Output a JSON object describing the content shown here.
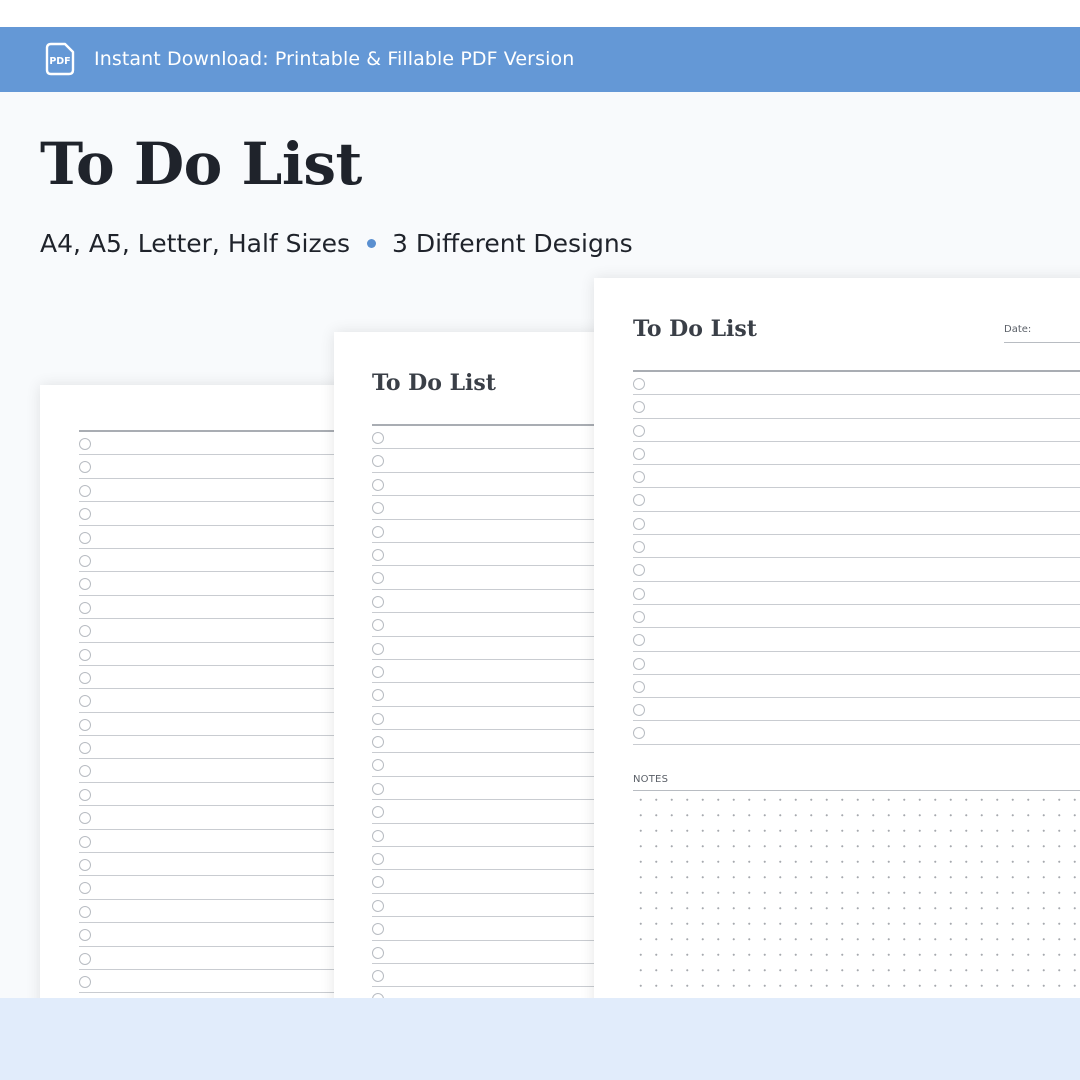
{
  "banner": {
    "icon_name": "pdf-file-icon",
    "icon_text": "PDF",
    "text": "Instant Download: Printable & Fillable PDF Version",
    "color": "#6498d6"
  },
  "title": "To Do List",
  "subtitle": {
    "left": "A4, A5, Letter, Half Sizes",
    "right": "3 Different Designs",
    "bullet_color": "#5a8fd0"
  },
  "sheets": {
    "design_1": {
      "title": "",
      "row_count": 24
    },
    "design_2": {
      "title": "To Do List",
      "row_count": 25
    },
    "design_3": {
      "title": "To Do List",
      "date_label": "Date:",
      "row_count": 16,
      "notes_label": "NOTES"
    }
  },
  "colors": {
    "bottom_band": "#e1ecfb",
    "background": "#f8fafc"
  }
}
